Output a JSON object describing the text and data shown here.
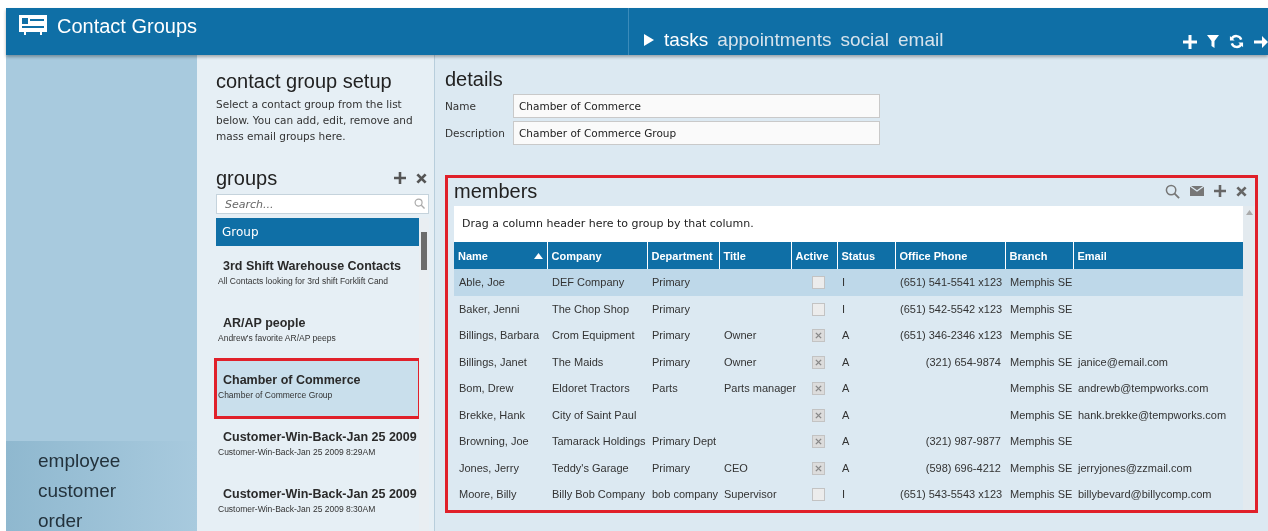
{
  "app": {
    "title": "Contact Groups"
  },
  "nav_tabs": [
    {
      "label": "tasks",
      "selected": true
    },
    {
      "label": "appointments",
      "selected": false
    },
    {
      "label": "social",
      "selected": false
    },
    {
      "label": "email",
      "selected": false
    }
  ],
  "sidebar": {
    "items": [
      {
        "label": "employee"
      },
      {
        "label": "customer"
      },
      {
        "label": "order"
      }
    ]
  },
  "setup": {
    "title": "contact group setup",
    "description": "Select a contact group from the list below.  You can add, edit, remove and mass email groups here."
  },
  "groups": {
    "title": "groups",
    "search": {
      "placeholder": "Search..."
    },
    "column": "Group",
    "items": [
      {
        "name": "3rd Shift Warehouse Contacts",
        "subtitle": "All Contacts looking for 3rd shift Forklift Cand",
        "selected": false,
        "highlighted": false
      },
      {
        "name": "AR/AP people",
        "subtitle": "Andrew's favorite AR/AP peeps",
        "selected": false,
        "highlighted": false
      },
      {
        "name": "Chamber of Commerce",
        "subtitle": "Chamber of Commerce Group",
        "selected": true,
        "highlighted": true
      },
      {
        "name": "Customer-Win-Back-Jan 25 2009",
        "subtitle": "Customer-Win-Back-Jan 25 2009  8:29AM",
        "selected": false,
        "highlighted": false
      },
      {
        "name": "Customer-Win-Back-Jan 25 2009",
        "subtitle": "Customer-Win-Back-Jan 25 2009  8:30AM",
        "selected": false,
        "highlighted": false
      }
    ]
  },
  "details": {
    "title": "details",
    "fields": [
      {
        "label": "Name",
        "value": "Chamber of Commerce"
      },
      {
        "label": "Description",
        "value": "Chamber of Commerce Group"
      }
    ]
  },
  "members": {
    "title": "members",
    "highlighted": true,
    "group_hint": "Drag a column header here to group by that column.",
    "columns": [
      {
        "label": "Name",
        "sorted": true
      },
      {
        "label": "Company",
        "sorted": false
      },
      {
        "label": "Department",
        "sorted": false
      },
      {
        "label": "Title",
        "sorted": false
      },
      {
        "label": "Active",
        "sorted": false
      },
      {
        "label": "Status",
        "sorted": false
      },
      {
        "label": "Office Phone",
        "sorted": false
      },
      {
        "label": "Branch",
        "sorted": false
      },
      {
        "label": "Email",
        "sorted": false
      }
    ],
    "rows": [
      {
        "name": "Able, Joe",
        "company": "DEF Company",
        "department": "Primary",
        "title": "",
        "active": false,
        "status": "I",
        "phone": "(651) 541-5541 x123",
        "branch": "Memphis SE",
        "email": "",
        "selected": true
      },
      {
        "name": "Baker, Jenni",
        "company": "The Chop Shop",
        "department": "Primary",
        "title": "",
        "active": false,
        "status": "I",
        "phone": "(651) 542-5542 x123",
        "branch": "Memphis SE",
        "email": "",
        "selected": false
      },
      {
        "name": "Billings, Barbara",
        "company": "Crom Equipment",
        "department": "Primary",
        "title": "Owner",
        "active": true,
        "status": "A",
        "phone": "(651) 346-2346 x123",
        "branch": "Memphis SE",
        "email": "",
        "selected": false
      },
      {
        "name": "Billings, Janet",
        "company": "The Maids",
        "department": "Primary",
        "title": "Owner",
        "active": true,
        "status": "A",
        "phone": "(321) 654-9874",
        "branch": "Memphis SE",
        "email": "janice@email.com",
        "selected": false
      },
      {
        "name": "Bom, Drew",
        "company": "Eldoret Tractors",
        "department": "Parts",
        "title": "Parts manager",
        "active": true,
        "status": "A",
        "phone": "",
        "branch": "Memphis SE",
        "email": "andrewb@tempworks.com",
        "selected": false
      },
      {
        "name": "Brekke, Hank",
        "company": "City of Saint Paul",
        "department": "",
        "title": "",
        "active": true,
        "status": "A",
        "phone": "",
        "branch": "Memphis SE",
        "email": "hank.brekke@tempworks.com",
        "selected": false
      },
      {
        "name": "Browning, Joe",
        "company": "Tamarack Holdings",
        "department": "Primary Dept",
        "title": "",
        "active": true,
        "status": "A",
        "phone": "(321) 987-9877",
        "branch": "Memphis SE",
        "email": "",
        "selected": false
      },
      {
        "name": "Jones, Jerry",
        "company": "Teddy's Garage",
        "department": "Primary",
        "title": "CEO",
        "active": true,
        "status": "A",
        "phone": "(598) 696-4212",
        "branch": "Memphis SE",
        "email": "jerryjones@zzmail.com",
        "selected": false
      },
      {
        "name": "Moore, Billy",
        "company": "Billy Bob Company",
        "department": "bob company",
        "title": "Supervisor",
        "active": false,
        "status": "I",
        "phone": "(651) 543-5543 x123",
        "branch": "Memphis SE",
        "email": "billybevard@billycomp.com",
        "selected": false
      }
    ]
  }
}
